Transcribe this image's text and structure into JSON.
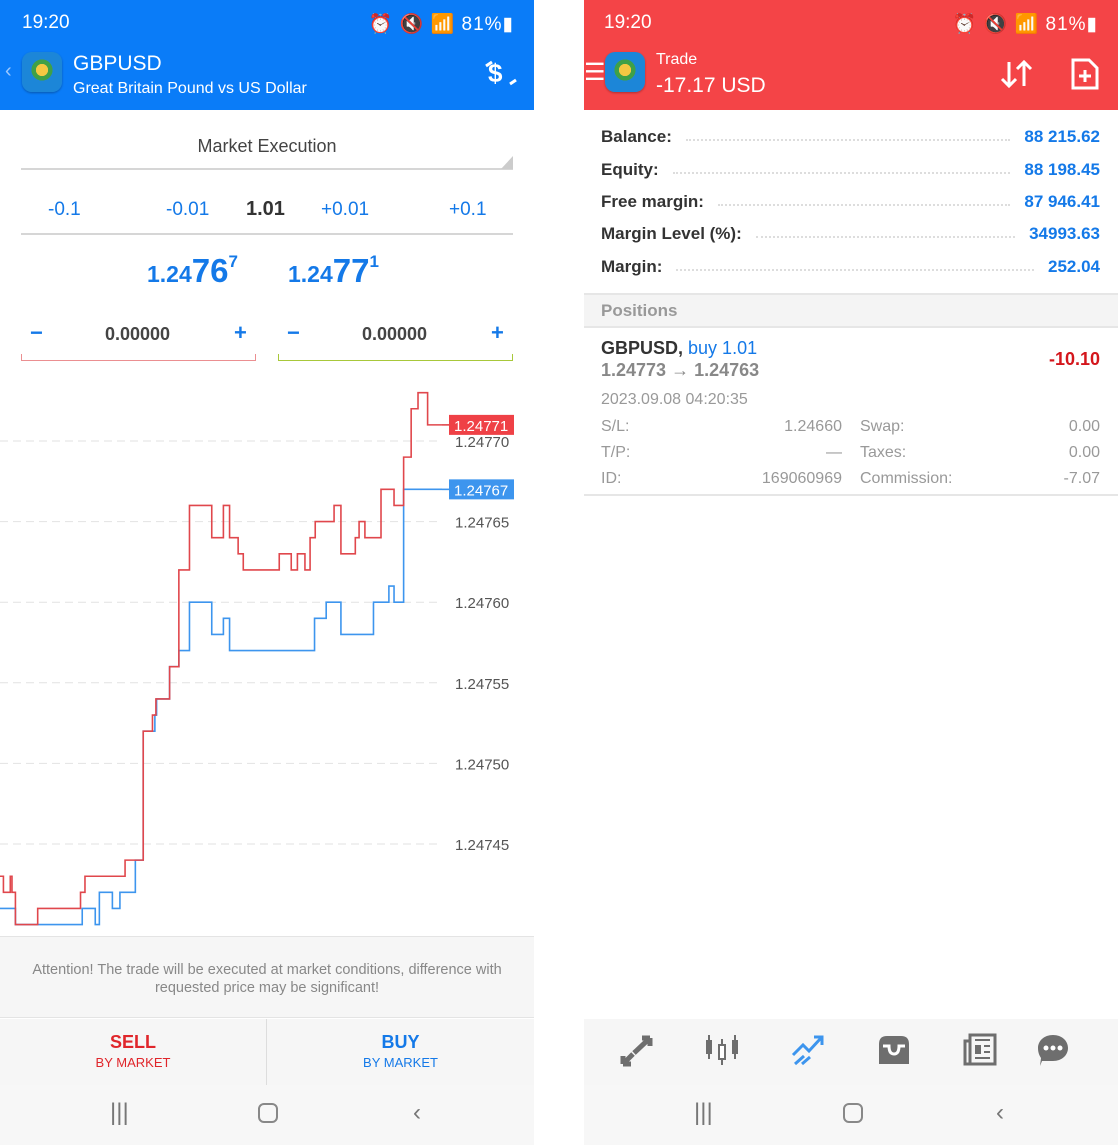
{
  "status_bar": {
    "time": "19:20",
    "battery": "81%"
  },
  "order": {
    "header": {
      "symbol": "GBPUSD",
      "description": "Great Britain Pound vs US Dollar",
      "color": "#0a7cf8"
    },
    "execution_type": "Market Execution",
    "volume": {
      "steps": [
        "-0.1",
        "-0.01",
        "+0.01",
        "+0.1"
      ],
      "value": "1.01"
    },
    "bid": {
      "prefix": "1.24",
      "big": "76",
      "sup": "7"
    },
    "ask": {
      "prefix": "1.24",
      "big": "77",
      "sup": "1"
    },
    "sl": {
      "minus": "−",
      "value": "0.00000",
      "plus": "+"
    },
    "tp": {
      "minus": "−",
      "value": "0.00000",
      "plus": "+"
    },
    "attention": "Attention! The trade will be executed at market conditions, difference with requested price may be significant!",
    "sell": {
      "label": "SELL",
      "sub": "BY MARKET",
      "color": "#e0262b"
    },
    "buy": {
      "label": "BUY",
      "sub": "BY MARKET",
      "color": "#1479e8"
    }
  },
  "chart_data": {
    "type": "line",
    "y_ticks": [
      "1.24770",
      "1.24765",
      "1.24760",
      "1.24755",
      "1.24750",
      "1.24745"
    ],
    "ylim": [
      1.247425,
      1.24774
    ],
    "grid": true,
    "ask_tag": "1.24771",
    "bid_tag": "1.24767",
    "series": [
      {
        "role": "ask",
        "color": "#e0474c",
        "steps": [
          [
            0,
            1.24743
          ],
          [
            1,
            1.24742
          ],
          [
            3,
            1.24743
          ],
          [
            3.5,
            1.24742
          ],
          [
            4.5,
            1.2474
          ],
          [
            11,
            1.24741
          ],
          [
            23.5,
            1.24742
          ],
          [
            24.8,
            1.24743
          ],
          [
            36.5,
            1.24744
          ],
          [
            41.8,
            1.24752
          ],
          [
            44.5,
            1.24753
          ],
          [
            45.5,
            1.24754
          ],
          [
            49.5,
            1.24756
          ],
          [
            52.2,
            1.24762
          ],
          [
            55.3,
            1.24766
          ],
          [
            61.8,
            1.24764
          ],
          [
            65.2,
            1.24766
          ],
          [
            67,
            1.24764
          ],
          [
            69.5,
            1.24763
          ],
          [
            71,
            1.24762
          ],
          [
            81.5,
            1.24763
          ],
          [
            85,
            1.24762
          ],
          [
            86.8,
            1.24763
          ],
          [
            89,
            1.24762
          ],
          [
            90.5,
            1.24764
          ],
          [
            92,
            1.24765
          ],
          [
            97.5,
            1.24766
          ],
          [
            99.5,
            1.24763
          ],
          [
            103.7,
            1.24764
          ],
          [
            104.8,
            1.24765
          ],
          [
            106.5,
            1.24764
          ],
          [
            111.2,
            1.24767
          ],
          [
            115,
            1.24766
          ],
          [
            117.8,
            1.24769
          ],
          [
            120,
            1.24772
          ],
          [
            122,
            1.24773
          ],
          [
            124.8,
            1.24771
          ],
          [
            129,
            1.24771
          ]
        ]
      },
      {
        "role": "bid",
        "color": "#3d95ee",
        "steps": [
          [
            0,
            1.24741
          ],
          [
            4.5,
            1.2474
          ],
          [
            24,
            1.24741
          ],
          [
            27.8,
            1.2474
          ],
          [
            29,
            1.24742
          ],
          [
            32.8,
            1.24741
          ],
          [
            35,
            1.24742
          ],
          [
            39.5,
            1.24744
          ],
          [
            41.8,
            1.24752
          ],
          [
            45.2,
            1.24753
          ],
          [
            45.7,
            1.24754
          ],
          [
            49.5,
            1.24756
          ],
          [
            52.2,
            1.24757
          ],
          [
            55.3,
            1.2476
          ],
          [
            61.8,
            1.24758
          ],
          [
            65.2,
            1.24759
          ],
          [
            67,
            1.24757
          ],
          [
            91.8,
            1.24759
          ],
          [
            95.2,
            1.2476
          ],
          [
            99.5,
            1.24758
          ],
          [
            109,
            1.2476
          ],
          [
            113.5,
            1.24761
          ],
          [
            115,
            1.2476
          ],
          [
            117.8,
            1.24767
          ],
          [
            129,
            1.24767
          ]
        ]
      }
    ]
  },
  "trade": {
    "header": {
      "title": "Trade",
      "profit": "-17.17 USD",
      "color": "#f44447"
    },
    "account": [
      {
        "label": "Balance:",
        "value": "88 215.62"
      },
      {
        "label": "Equity:",
        "value": "88 198.45"
      },
      {
        "label": "Free margin:",
        "value": "87 946.41"
      },
      {
        "label": "Margin Level (%):",
        "value": "34993.63"
      },
      {
        "label": "Margin:",
        "value": "252.04"
      }
    ],
    "positions_title": "Positions",
    "position": {
      "symbol": "GBPUSD,",
      "side": "buy 1.01",
      "prices": "1.24773 → 1.24763",
      "profit": "-10.10",
      "time": "2023.09.08 04:20:35",
      "sl_label": "S/L:",
      "sl": "1.24660",
      "tp_label": "T/P:",
      "tp": "—",
      "id_label": "ID:",
      "id": "169060969",
      "swap_label": "Swap:",
      "swap": "0.00",
      "taxes_label": "Taxes:",
      "taxes": "0.00",
      "commission_label": "Commission:",
      "commission": "-7.07"
    },
    "tabs": [
      {
        "icon": "quotes-icon"
      },
      {
        "icon": "chart-icon"
      },
      {
        "icon": "trade-icon",
        "active": true
      },
      {
        "icon": "history-icon"
      },
      {
        "icon": "news-icon"
      },
      {
        "icon": "chat-icon"
      }
    ]
  }
}
